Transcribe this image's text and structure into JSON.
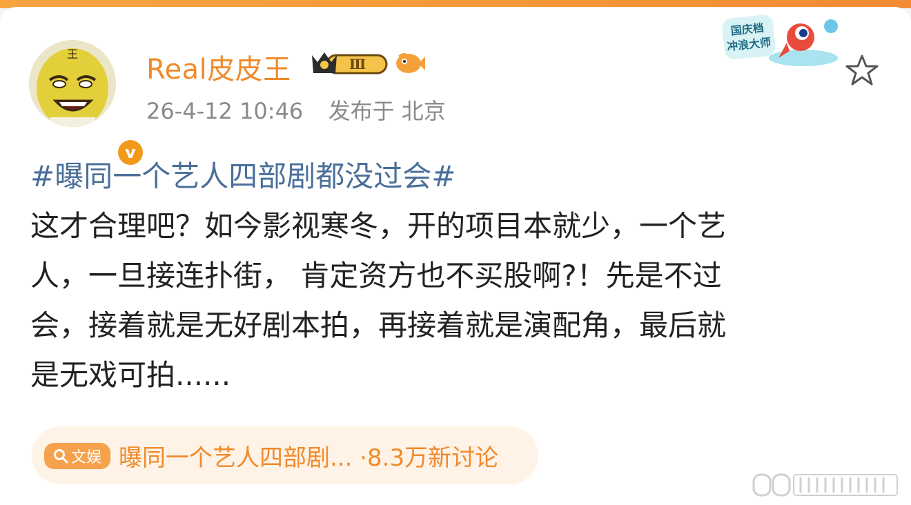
{
  "post": {
    "username": "Real皮皮王",
    "level_badge": "Ⅲ",
    "verified_mark": "v",
    "timestamp": "26-4-12 10:46",
    "location": "发布于 北京",
    "hashtag": "#曝同一个艺人四部剧都没过会#",
    "paragraphs": [
      "这才合理吧？如今影视寒冬，开的项目本就少，一个艺",
      "人，一旦接连扑街， 肯定资方也不买股啊?！先是不过",
      "会，接着就是无好剧本拍，再接着就是演配角，最后就",
      "是无戏可拍......"
    ]
  },
  "corner_badge": {
    "line1": "国庆档",
    "line2": "冲浪大师"
  },
  "topic": {
    "tag": "文娱",
    "title": "曝同一个艺人四部剧...",
    "meta": " ·8.3万新讨论"
  },
  "colors": {
    "accent": "#f08a2a",
    "hashtag": "#4a6f9a",
    "meta_text": "#8a8a8a"
  }
}
